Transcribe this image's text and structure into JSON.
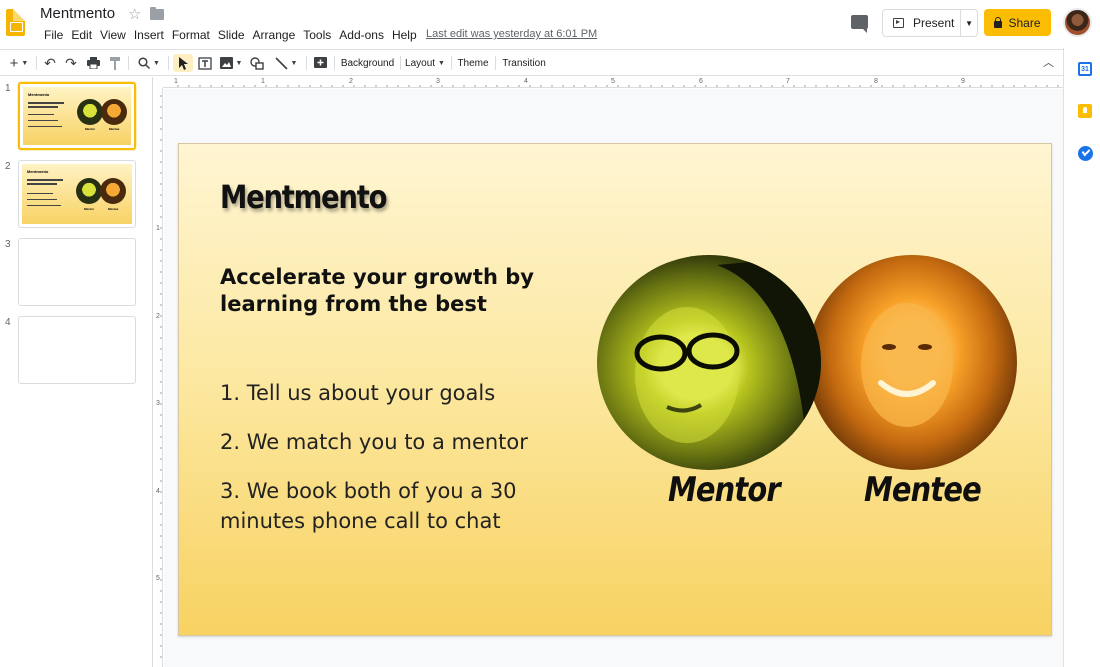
{
  "app": {
    "doc_title": "Mentmento",
    "menu": [
      "File",
      "Edit",
      "View",
      "Insert",
      "Format",
      "Slide",
      "Arrange",
      "Tools",
      "Add-ons",
      "Help"
    ],
    "last_edit": "Last edit was yesterday at 6:01 PM",
    "present_label": "Present",
    "share_label": "Share"
  },
  "toolbar": {
    "background_label": "Background",
    "layout_label": "Layout",
    "theme_label": "Theme",
    "transition_label": "Transition"
  },
  "side_panel": {
    "calendar_day": "31"
  },
  "ruler": {
    "top": [
      "1",
      "1",
      "2",
      "3",
      "4",
      "5",
      "6",
      "7",
      "8",
      "9"
    ],
    "left": [
      "1",
      "2",
      "3",
      "4",
      "5"
    ]
  },
  "filmstrip": {
    "slides": [
      {
        "number": "1",
        "active": true
      },
      {
        "number": "2",
        "active": false
      },
      {
        "number": "3",
        "active": false
      },
      {
        "number": "4",
        "active": false
      }
    ]
  },
  "slide": {
    "title": "Mentmento",
    "subtitle": "Accelerate your growth by learning from the best",
    "steps": [
      "1. Tell us about your goals",
      "2. We match you to a mentor",
      "3. We book both of you a 30 minutes phone call to chat"
    ],
    "mentor_label": "Mentor",
    "mentee_label": "Mentee"
  },
  "colors": {
    "share_button": "#fbbc04",
    "active_thumbnail_border": "#fbbc04",
    "slide_background_top": "#fff5d2",
    "slide_background_bottom": "#f8d262"
  }
}
